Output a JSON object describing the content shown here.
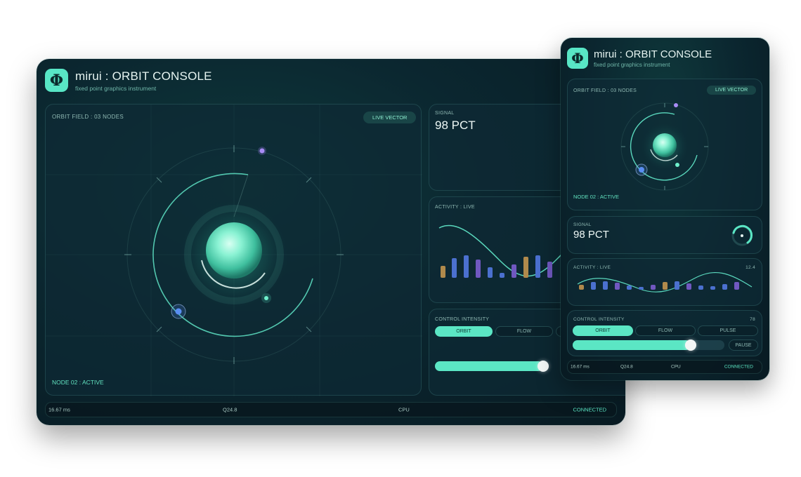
{
  "app": {
    "brand": "mirui : ORBIT CONSOLE",
    "tagline": "fixed point graphics instrument",
    "logo_glyph": "Φ"
  },
  "orbit": {
    "label": "ORBIT FIELD : 03 NODES",
    "live_badge": "LIVE VECTOR",
    "node_status": "NODE 02 : ACTIVE"
  },
  "signal": {
    "label": "SIGNAL",
    "value": "98 PCT"
  },
  "activity": {
    "label": "ACTIVITY : LIVE",
    "reading": "12.4"
  },
  "control": {
    "label": "CONTROL",
    "intensity_label": "INTENSITY",
    "intensity_value": "78",
    "intensity_level": 0.78,
    "modes": [
      "ORBIT",
      "FLOW",
      "PULSE"
    ],
    "active_mode": "ORBIT",
    "pause_label": "PAUSE"
  },
  "status": {
    "frame_time": "16.67 ms",
    "format": "Q24.8",
    "cpu": "CPU",
    "connection": "CONNECTED"
  },
  "colors": {
    "accent": "#5be6c4",
    "node_violet": "#9b7cf0",
    "node_blue": "#4f86f0",
    "bar_amber": "#c99a4e",
    "bar_blue": "#4a6fd0",
    "bar_violet": "#7a5fc4"
  }
}
